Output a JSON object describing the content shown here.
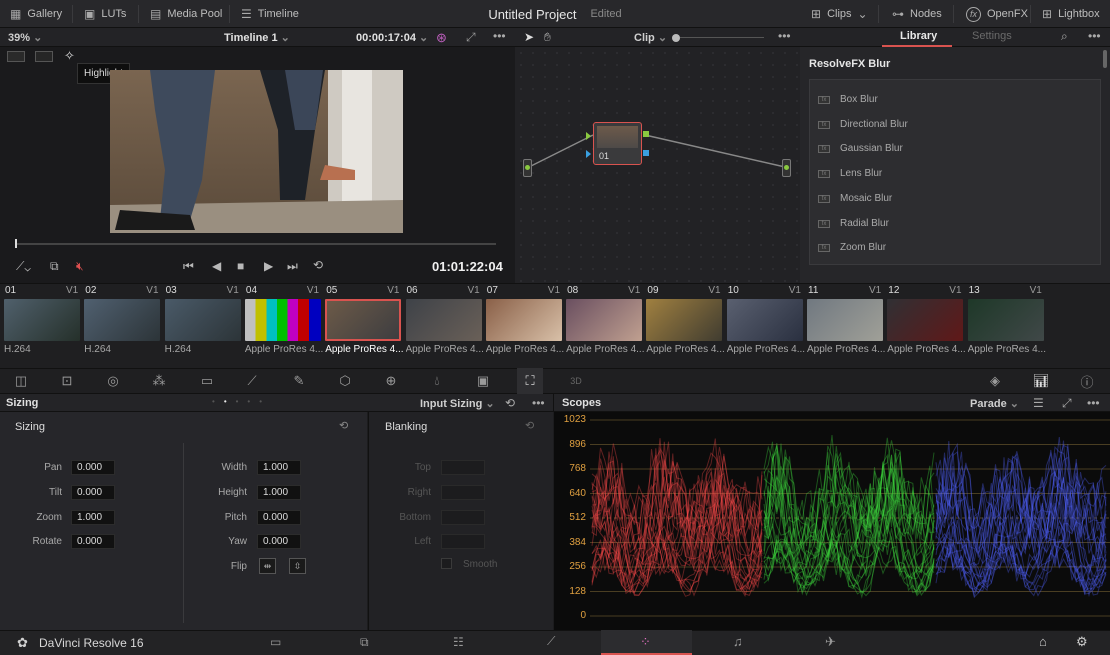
{
  "header": {
    "gallery": "Gallery",
    "luts": "LUTs",
    "media_pool": "Media Pool",
    "timeline": "Timeline",
    "project_title": "Untitled Project",
    "edited": "Edited",
    "clips": "Clips",
    "nodes": "Nodes",
    "openfx": "OpenFX",
    "lightbox": "Lightbox"
  },
  "viewer": {
    "zoom": "39%",
    "timeline_name": "Timeline 1",
    "timecode_top": "00:00:17:04",
    "tooltip": "Highlight",
    "timecode": "01:01:22:04"
  },
  "nodes": {
    "mode": "Clip",
    "node_label": "01"
  },
  "library": {
    "tab_library": "Library",
    "tab_settings": "Settings",
    "section_title": "ResolveFX Blur",
    "items": [
      "Box Blur",
      "Directional Blur",
      "Gaussian Blur",
      "Lens Blur",
      "Mosaic Blur",
      "Radial Blur",
      "Zoom Blur"
    ]
  },
  "clips": [
    {
      "num": "01",
      "track": "V1",
      "label": "H.264"
    },
    {
      "num": "02",
      "track": "V1",
      "label": "H.264"
    },
    {
      "num": "03",
      "track": "V1",
      "label": "H.264"
    },
    {
      "num": "04",
      "track": "V1",
      "label": "Apple ProRes 4..."
    },
    {
      "num": "05",
      "track": "V1",
      "label": "Apple ProRes 4..."
    },
    {
      "num": "06",
      "track": "V1",
      "label": "Apple ProRes 4..."
    },
    {
      "num": "07",
      "track": "V1",
      "label": "Apple ProRes 4..."
    },
    {
      "num": "08",
      "track": "V1",
      "label": "Apple ProRes 4..."
    },
    {
      "num": "09",
      "track": "V1",
      "label": "Apple ProRes 4..."
    },
    {
      "num": "10",
      "track": "V1",
      "label": "Apple ProRes 4..."
    },
    {
      "num": "11",
      "track": "V1",
      "label": "Apple ProRes 4..."
    },
    {
      "num": "12",
      "track": "V1",
      "label": "Apple ProRes 4..."
    },
    {
      "num": "13",
      "track": "V1",
      "label": "Apple ProRes 4..."
    }
  ],
  "sizing": {
    "panel_title": "Sizing",
    "mode": "Input Sizing",
    "section": "Sizing",
    "pan_label": "Pan",
    "pan": "0.000",
    "tilt_label": "Tilt",
    "tilt": "0.000",
    "zoom_label": "Zoom",
    "zoom": "1.000",
    "rotate_label": "Rotate",
    "rotate": "0.000",
    "width_label": "Width",
    "width": "1.000",
    "height_label": "Height",
    "height": "1.000",
    "pitch_label": "Pitch",
    "pitch": "0.000",
    "yaw_label": "Yaw",
    "yaw": "0.000",
    "flip_label": "Flip",
    "blanking": "Blanking",
    "top_label": "Top",
    "right_label": "Right",
    "bottom_label": "Bottom",
    "left_label": "Left",
    "smooth_label": "Smooth"
  },
  "scopes": {
    "title": "Scopes",
    "mode": "Parade",
    "y_ticks": [
      "1023",
      "896",
      "768",
      "640",
      "512",
      "384",
      "256",
      "128",
      "0"
    ]
  },
  "footer": {
    "app_name": "DaVinci Resolve 16"
  },
  "colors": {
    "accent": "#d9534f",
    "scope_label": "#e0a040"
  }
}
